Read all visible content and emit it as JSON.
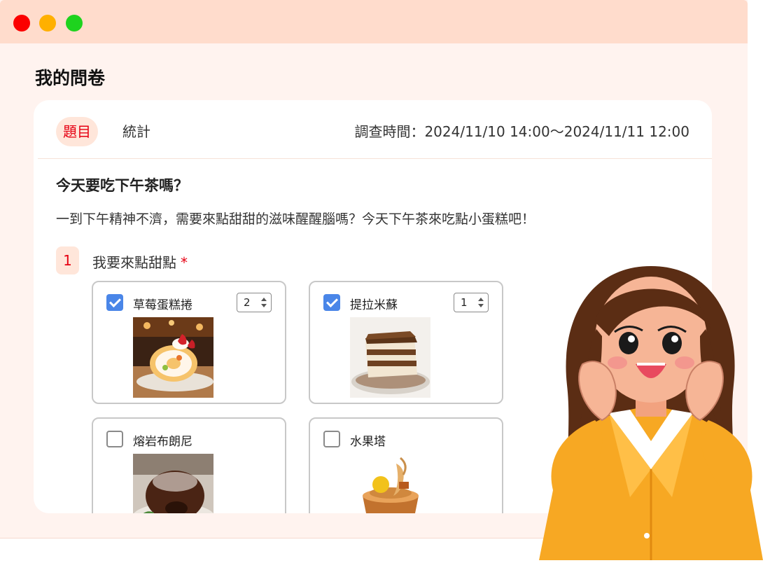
{
  "page": {
    "title": "我的問卷"
  },
  "tabs": {
    "questions": "題目",
    "stats": "統計"
  },
  "survey_time": "調查時間：2024/11/10 14:00～2024/11/11 12:00",
  "question": {
    "title": "今天要吃下午茶嗎？",
    "description": "一到下午精神不濟，需要來點甜甜的滋味醒醒腦嗎？今天下午茶來吃點小蛋糕吧！",
    "item": {
      "number": "1",
      "label": "我要來點甜點",
      "required_mark": "*",
      "options": [
        {
          "name": "草莓蛋糕捲",
          "checked": true,
          "quantity": "2",
          "image_icon": "strawberry-roll-cake-photo"
        },
        {
          "name": "提拉米蘇",
          "checked": true,
          "quantity": "1",
          "image_icon": "tiramisu-photo"
        },
        {
          "name": "熔岩布朗尼",
          "checked": false,
          "image_icon": "lava-brownie-photo"
        },
        {
          "name": "水果塔",
          "checked": false,
          "image_icon": "fruit-tart-photo"
        }
      ]
    }
  },
  "colors": {
    "accent": "#e60012",
    "checkbox": "#4a86e8",
    "titlebar": "#ffdccc",
    "window_bg": "#fff3ef"
  }
}
